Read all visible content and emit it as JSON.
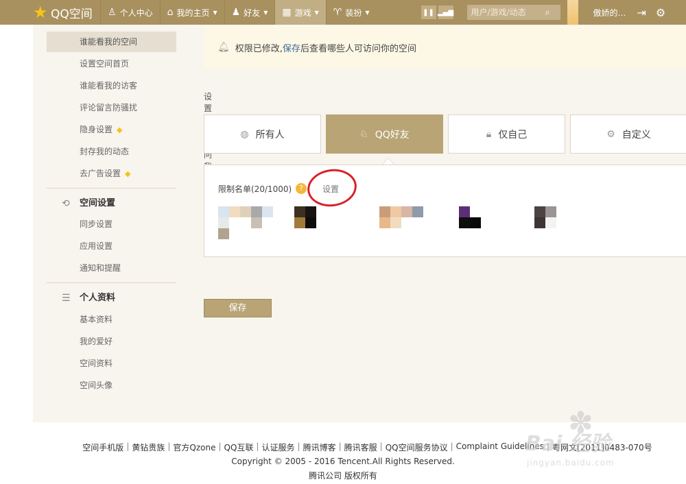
{
  "topbar": {
    "logo_text": "QQ空间",
    "nav": [
      {
        "label": "个人中心",
        "icon": "user-icon"
      },
      {
        "label": "我的主页",
        "icon": "home-icon"
      },
      {
        "label": "好友",
        "icon": "friends-icon"
      },
      {
        "label": "游戏",
        "icon": "grid-icon"
      },
      {
        "label": "装扮",
        "icon": "shirt-icon"
      }
    ],
    "search_placeholder": "用户/游戏/动态",
    "username": "傲娇的…"
  },
  "sidebar": {
    "privacy_items": [
      {
        "label": "谁能看我的空间"
      },
      {
        "label": "设置空间首页"
      },
      {
        "label": "谁能看我的访客"
      },
      {
        "label": "评论留言防骚扰"
      },
      {
        "label": "隐身设置"
      },
      {
        "label": "封存我的动态"
      },
      {
        "label": "去广告设置"
      }
    ],
    "space_heading": "空间设置",
    "space_items": [
      {
        "label": "同步设置"
      },
      {
        "label": "应用设置"
      },
      {
        "label": "通知和提醒"
      }
    ],
    "profile_heading": "个人资料",
    "profile_items": [
      {
        "label": "基本资料"
      },
      {
        "label": "我的爱好"
      },
      {
        "label": "空间资料"
      },
      {
        "label": "空间头像"
      }
    ]
  },
  "main": {
    "notice_before": "权限已修改,",
    "notice_link": "保存",
    "notice_after": "后查看哪些人可访问你的空间",
    "section_label": "设置谁能访问我的空间:",
    "options": [
      {
        "label": "所有人",
        "icon": "globe-icon"
      },
      {
        "label": "QQ好友",
        "icon": "qq-penguin-icon"
      },
      {
        "label": "仅自己",
        "icon": "lock-icon"
      },
      {
        "label": "自定义",
        "icon": "gear-icon"
      }
    ],
    "selected_option": "QQ好友",
    "limit_label": "限制名单(20/1000)",
    "help_mark": "?",
    "settings_link": "设置",
    "save_button": "保存"
  },
  "footer": {
    "links": [
      "空间手机版",
      "黄钻贵族",
      "官方Qzone",
      "QQ互联",
      "认证服务",
      "腾讯博客",
      "腾讯客服",
      "QQ空间服务协议",
      "Complaint Guidelines",
      "粤网文[2011]0483-070号"
    ],
    "copyright": "Copyright © 2005 - 2016 Tencent.All Rights Reserved.",
    "company": "腾讯公司 版权所有"
  },
  "colors": {
    "topbar": "#a8905f",
    "accent": "#b8a474",
    "annotation": "#d8212a",
    "diamond": "#f3c316"
  },
  "watermark": {
    "text": "Bai 经验",
    "sub": "jingyan.baidu.com"
  }
}
